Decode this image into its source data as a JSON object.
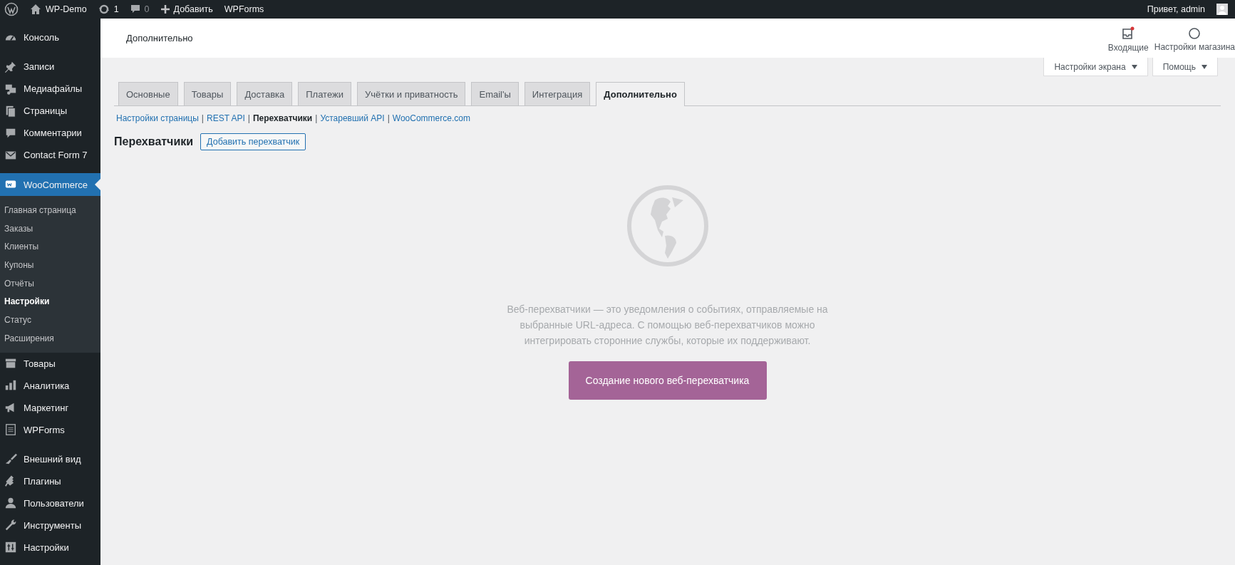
{
  "admin_bar": {
    "site": "WP-Demo",
    "updates": "1",
    "comments": "0",
    "new": "Добавить",
    "plugin": "WPForms",
    "greeting": "Привет, admin"
  },
  "sidebar": {
    "groups": [
      [
        {
          "label": "Консоль",
          "selected": false
        }
      ],
      [
        {
          "label": "Записи",
          "selected": false
        },
        {
          "label": "Медиафайлы",
          "selected": false
        },
        {
          "label": "Страницы",
          "selected": false
        },
        {
          "label": "Комментарии",
          "selected": false
        },
        {
          "label": "Contact Form 7",
          "selected": false
        }
      ],
      [
        {
          "label": "WooCommerce",
          "selected": true,
          "children": [
            {
              "label": "Главная страница",
              "selected": false
            },
            {
              "label": "Заказы",
              "selected": false
            },
            {
              "label": "Клиенты",
              "selected": false
            },
            {
              "label": "Купоны",
              "selected": false
            },
            {
              "label": "Отчёты",
              "selected": false
            },
            {
              "label": "Настройки",
              "selected": true
            },
            {
              "label": "Статус",
              "selected": false
            },
            {
              "label": "Расширения",
              "selected": false
            }
          ]
        },
        {
          "label": "Товары",
          "selected": false
        },
        {
          "label": "Аналитика",
          "selected": false
        },
        {
          "label": "Маркетинг",
          "selected": false
        },
        {
          "label": "WPForms",
          "selected": false
        }
      ],
      [
        {
          "label": "Внешний вид",
          "selected": false
        },
        {
          "label": "Плагины",
          "selected": false
        },
        {
          "label": "Пользователи",
          "selected": false
        },
        {
          "label": "Инструменты",
          "selected": false
        },
        {
          "label": "Настройки",
          "selected": false
        }
      ]
    ]
  },
  "header": {
    "title": "Дополнительно",
    "inbox": {
      "label": "Входящие",
      "unread": true
    },
    "store_settings": "Настройки магазина"
  },
  "screen_buttons": [
    "Настройки экрана",
    "Помощь"
  ],
  "tabs": [
    {
      "label": "Основные",
      "selected": false
    },
    {
      "label": "Товары",
      "selected": false
    },
    {
      "label": "Доставка",
      "selected": false
    },
    {
      "label": "Платежи",
      "selected": false
    },
    {
      "label": "Учётки и приватность",
      "selected": false
    },
    {
      "label": "Email'ы",
      "selected": false
    },
    {
      "label": "Интеграция",
      "selected": false
    },
    {
      "label": "Дополнительно",
      "selected": true
    }
  ],
  "sections": [
    {
      "kind": "link",
      "text": "Настройки страницы",
      "selected": false
    },
    {
      "kind": "separator",
      "text": "|"
    },
    {
      "kind": "link",
      "text": "REST API",
      "selected": false
    },
    {
      "kind": "separator",
      "text": "|"
    },
    {
      "kind": "link",
      "text": "Перехватчики",
      "selected": true
    },
    {
      "kind": "separator",
      "text": "|"
    },
    {
      "kind": "link",
      "text": "Устаревший API",
      "selected": false
    },
    {
      "kind": "separator",
      "text": "|"
    },
    {
      "kind": "link",
      "text": "WooCommerce.com",
      "selected": false
    }
  ],
  "page": {
    "heading": "Перехватчики",
    "add_button": "Добавить перехватчик"
  },
  "empty_state": {
    "description": "Веб-перехватчики — это уведомления о событиях, отправляемые на выбранные URL-адреса. С помощью веб-перехватчиков можно интегрировать сторонние службы, которые их поддерживают.",
    "button": "Создание нового веб-перехватчика"
  }
}
